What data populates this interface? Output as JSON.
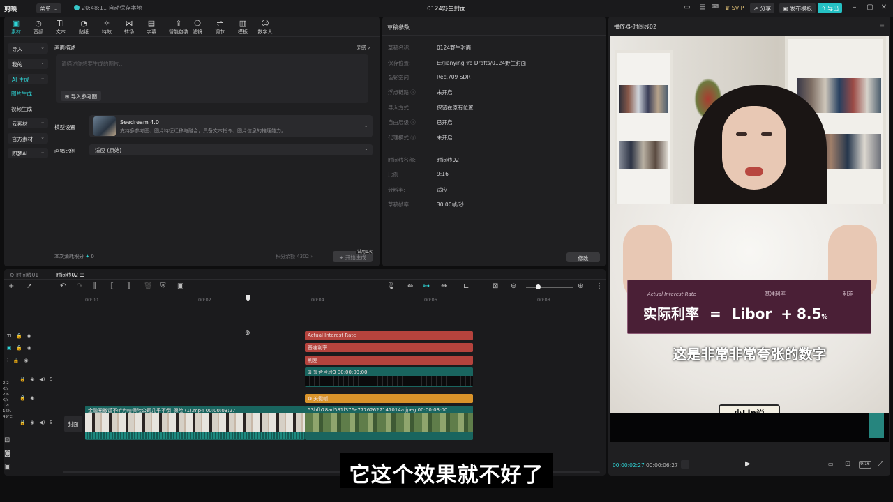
{
  "app": {
    "logo": "剪映",
    "menu_label": "菜单",
    "status": "20:48:11 自动保存本地",
    "title": "0124野生封面",
    "buttons": [
      "SVIP",
      "分享",
      "发布模板",
      "导出"
    ]
  },
  "toolbar": {
    "items": [
      {
        "label": "素材",
        "icon": "material-icon",
        "glyph": "▣",
        "active": true
      },
      {
        "label": "音频",
        "icon": "audio-icon",
        "glyph": "◷"
      },
      {
        "label": "文本",
        "icon": "text-icon",
        "glyph": "TI"
      },
      {
        "label": "贴纸",
        "icon": "sticker-icon",
        "glyph": "◔"
      },
      {
        "label": "特效",
        "icon": "effect-icon",
        "glyph": "✧"
      },
      {
        "label": "转场",
        "icon": "transition-icon",
        "glyph": "⋈"
      },
      {
        "label": "字幕",
        "icon": "caption-icon",
        "glyph": "▤"
      },
      {
        "label": "智能包装",
        "icon": "smart-pack-icon",
        "glyph": "⇪"
      },
      {
        "label": "滤镜",
        "icon": "filter-icon",
        "glyph": "❍"
      },
      {
        "label": "调节",
        "icon": "adjust-icon",
        "glyph": "⇌"
      },
      {
        "label": "模板",
        "icon": "template-icon",
        "glyph": "▥"
      },
      {
        "label": "数字人",
        "icon": "digital-human-icon",
        "glyph": "☺"
      }
    ]
  },
  "sidebar": {
    "items": [
      {
        "label": "导入",
        "has_arrow": true
      },
      {
        "label": "我的",
        "has_arrow": true
      },
      {
        "label": "AI 生成",
        "has_arrow": true,
        "active": true
      },
      {
        "label": "图片生成",
        "sub": true,
        "active": true
      },
      {
        "label": "视频生成",
        "sub": true
      },
      {
        "label": "云素材",
        "has_arrow": true
      },
      {
        "label": "官方素材",
        "has_arrow": true
      },
      {
        "label": "即梦AI",
        "has_arrow": true
      }
    ]
  },
  "ai_panel": {
    "desc_label": "画面描述",
    "inspiration_label": "灵感 ›",
    "textarea_placeholder": "请描述你想要生成的图片...",
    "import_ref_label": "导入参考图",
    "model_label": "模型设置",
    "model_name": "Seedream 4.0",
    "model_desc": "支持多参考图、图片特征迁移与融合，具备文本指令、图片信息的推理能力。",
    "ratio_label": "画幅比例",
    "ratio_value": "适应 (原始)",
    "cost_label": "本次消耗积分",
    "cost_value": "0",
    "balance_label": "积分余额 4302 ›",
    "trial_badge": "试用1次",
    "generate_label": "开始生成"
  },
  "draft_params": {
    "title": "草稿参数",
    "rows": [
      {
        "k": "草稿名称:",
        "v": "0124野生封面"
      },
      {
        "k": "保存位置:",
        "v": "E:/JianyingPro Drafts/0124野生封面"
      },
      {
        "k": "色彩空间:",
        "v": "Rec.709 SDR"
      },
      {
        "k": "浮点链路 ⓘ",
        "v": "未开启"
      },
      {
        "k": "导入方式:",
        "v": "保留在原有位置"
      },
      {
        "k": "自由层级 ⓘ",
        "v": "已开启"
      },
      {
        "k": "代理模式 ⓘ",
        "v": "未开启"
      },
      {
        "k": "时间线名称:",
        "v": "时间线02"
      },
      {
        "k": "比例:",
        "v": "9:16"
      },
      {
        "k": "分辨率:",
        "v": "适应"
      },
      {
        "k": "草稿帧率:",
        "v": "30.00帧/秒"
      }
    ],
    "modify_label": "修改"
  },
  "player": {
    "title": "播放器-时间线02",
    "overlay": {
      "labels": [
        "Actual Interest Rate",
        "基准利率",
        "利差"
      ],
      "formula_left": "实际利率",
      "formula_eq": "=",
      "formula_libor": "Libor",
      "formula_plus": "+",
      "formula_value": "8.5",
      "formula_unit": "%"
    },
    "caption": "这是非常非常夸张的数字",
    "badge": "小Lin说",
    "current_time": "00:00:02:27",
    "total_time": "00:00:06:27",
    "ratio": "9:16"
  },
  "timeline": {
    "tabs": [
      "时间线01",
      "时间线02"
    ],
    "ruler": [
      "00:00",
      "00:02",
      "00:04",
      "00:06",
      "00:08"
    ],
    "cover_label": "封面",
    "clips": {
      "text1": "Actual Interest Rate",
      "text2": "基准利率",
      "text3": "利差",
      "compound": "复合片段3  00:00:03:00",
      "effect": "关键帧",
      "video1": "金融圈撒谎不听为啥保险公司几乎不倒_保险 (1).mp4  00:00:03:27",
      "video2": "53bfb78ad581f376e77762627141014a.jpeg  00:00:03:00"
    },
    "left_stats": [
      "2.2",
      "K/s",
      "2.6",
      "K/s",
      "CPU",
      "16%",
      "49°C"
    ]
  },
  "subtitle": "它这个效果就不好了",
  "colors": {
    "accent": "#2fd6d8",
    "text_clip": "#b5433d",
    "video_clip": "#19655f",
    "effect_clip": "#d9932a"
  }
}
